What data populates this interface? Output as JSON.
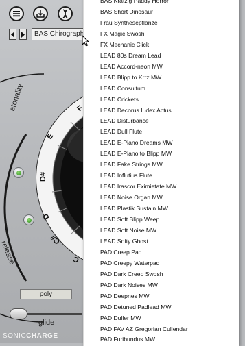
{
  "toolbar": {
    "menu_icon": "hamburger-icon",
    "save_icon": "download-icon",
    "dna_icon": "dna-icon"
  },
  "preset": {
    "name": "BAS Chirograph"
  },
  "dial": {
    "notes": [
      "F",
      "E",
      "D#",
      "D",
      "C#",
      "C"
    ],
    "knob_labels": {
      "atonality": "atonality",
      "release": "release"
    }
  },
  "voice_mode": "poly",
  "glide_label": "glide",
  "brand": {
    "sonic": "SONIC",
    "charge": "CHARGE"
  },
  "menu_items": [
    "BAS Kratzig Paddy Horror",
    "BAS Short Dinosaur",
    "Frau Synthesepflanze",
    "FX Magic Swosh",
    "FX Mechanic Click",
    "LEAD 80s Dream Lead",
    "LEAD Accord-neon MW",
    "LEAD Blipp to Krrz MW",
    "LEAD Consultum",
    "LEAD Crickets",
    "LEAD Decorus Iudex Actus",
    "LEAD Disturbance",
    "LEAD Dull Flute",
    "LEAD E-Piano Dreams MW",
    "LEAD E-Piano to Blipp MW",
    "LEAD Fake Strings MW",
    "LEAD Influtius Flute",
    "LEAD Irascor Eximietate MW",
    "LEAD Noise Organ MW",
    "LEAD Plastik Sustain MW",
    "LEAD Soft Blipp Weep",
    "LEAD Soft Noise MW",
    "LEAD Softy Ghost",
    "PAD Creep Pad",
    "PAD Creepy Waterpad",
    "PAD Dark Creep Swosh",
    "PAD Dark Noises MW",
    "PAD Deepnes MW",
    "PAD Detuned Padlead MW",
    "PAD Duller MW",
    "PAD FAV AZ Gregorian Cullendar",
    "PAD Furibundus MW"
  ],
  "colors": {
    "menu_bg": "#ffffff",
    "panel_bg": "#b9bbbe",
    "knob_led": "#3a9a2a"
  }
}
